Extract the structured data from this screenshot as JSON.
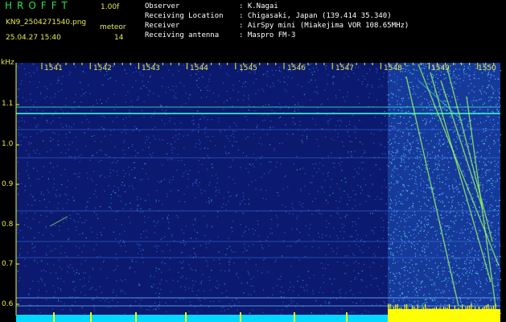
{
  "header": {
    "app_title": "HROFFT",
    "version": "1.00f",
    "filename": "KN9_2504271540.png",
    "mode": "meteor",
    "datetime": "25.04.27 15:40",
    "count": "14"
  },
  "info": [
    {
      "label": "Observer",
      "value": ": K.Nagai"
    },
    {
      "label": "Receiving Location",
      "value": ": Chigasaki, Japan (139.414 35.340)"
    },
    {
      "label": "Receiver",
      "value": ": AirSpy mini (Miakejima VOR 108.65MHz)"
    },
    {
      "label": "Receiving antenna",
      "value": ": Maspro FM-3"
    }
  ],
  "spectrogram": {
    "y_unit": "kHz",
    "y_ticks": [
      "1.1",
      "1.0",
      "0.9",
      "0.8",
      "0.7",
      "0.6"
    ],
    "x_ticks": [
      "1541",
      "1542",
      "1543",
      "1544",
      "1545",
      "1546",
      "1547",
      "1548",
      "1549",
      "1550"
    ],
    "colors": {
      "background": "#0b1a6e",
      "noise": "#3a6fff",
      "signal": "#35e0c8",
      "meteor": "#9cff60",
      "power_bar": "#ffff00",
      "baseline": "#00d8ff"
    }
  }
}
